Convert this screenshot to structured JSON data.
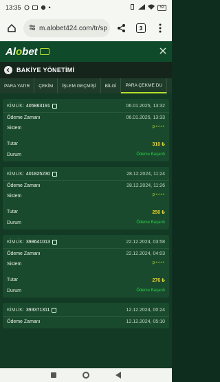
{
  "status_bar": {
    "time": "13:35",
    "battery": "52"
  },
  "browser": {
    "url": "m.alobet424.com/tr/sp",
    "tab_count": "3"
  },
  "app": {
    "logo_a": "Al",
    "logo_o": "o",
    "logo_b": "bet"
  },
  "section": {
    "title": "BAKİYE YÖNETİMİ"
  },
  "tabs": [
    "PARA YATIR",
    "ÇEKİM",
    "İŞLEM GEÇMİŞİ",
    "BİLGİ",
    "PARA ÇEKME DU"
  ],
  "labels": {
    "id": "KİMLİK:",
    "payment_time": "Ödeme Zamanı",
    "system": "Sistem",
    "amount": "Tutar",
    "status": "Durum"
  },
  "transactions": [
    {
      "id": "405863191",
      "date": "06.01.2025, 13:32",
      "payment_time": "06.01.2025, 13:33",
      "system": "P****",
      "amount": "310 ₺",
      "status": "Ödeme Başarılı"
    },
    {
      "id": "401825230",
      "date": "28.12.2024, 11:24",
      "payment_time": "28.12.2024, 11:26",
      "system": "P****",
      "amount": "250 ₺",
      "status": "Ödeme Başarılı"
    },
    {
      "id": "398641013",
      "date": "22.12.2024, 03:58",
      "payment_time": "22.12.2024, 04:03",
      "system": "P****",
      "amount": "276 ₺",
      "status": "Ödeme Başarılı"
    },
    {
      "id": "393371311",
      "date": "12.12.2024, 00:24",
      "payment_time": "12.12.2024, 05:10",
      "system": "",
      "amount": "",
      "status": ""
    }
  ]
}
